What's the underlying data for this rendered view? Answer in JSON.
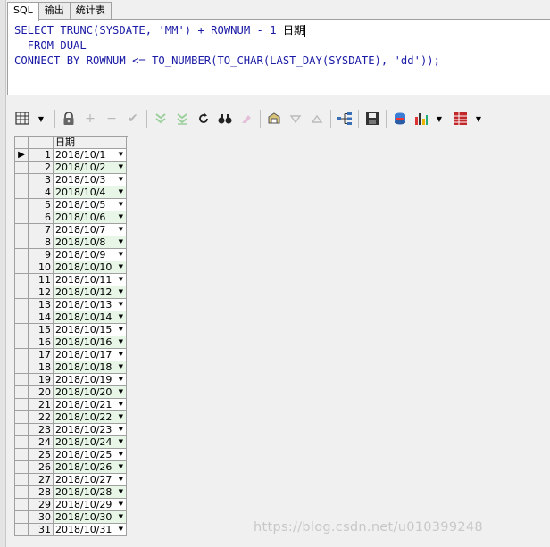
{
  "tabs": [
    {
      "label": "SQL"
    },
    {
      "label": "输出"
    },
    {
      "label": "统计表"
    }
  ],
  "editor": {
    "line1": {
      "a": "SELECT TRUNC(SYSDATE, ",
      "b": "'MM'",
      "c": ") + ROWNUM - ",
      "d": "1",
      "e": " 日期"
    },
    "line2": "  FROM DUAL",
    "line3": {
      "a": "CONNECT BY ROWNUM <= TO_NUMBER(TO_CHAR(LAST_DAY(SYSDATE), ",
      "b": "'dd'",
      "c": "));"
    }
  },
  "toolbar": {
    "icons": [
      "grid-layout-icon",
      "lock-icon",
      "add-row-icon",
      "delete-row-icon",
      "post-icon",
      "fetch-next-icon",
      "fetch-last-icon",
      "refresh-icon",
      "find-icon",
      "clear-icon",
      "query-by-example-icon",
      "sort-desc-icon",
      "sort-asc-icon",
      "tree-icon",
      "save-icon",
      "export-icon",
      "chart-icon",
      "table-icon"
    ]
  },
  "grid": {
    "header": "日期",
    "rows": [
      {
        "n": "1",
        "v": "2018/10/1"
      },
      {
        "n": "2",
        "v": "2018/10/2"
      },
      {
        "n": "3",
        "v": "2018/10/3"
      },
      {
        "n": "4",
        "v": "2018/10/4"
      },
      {
        "n": "5",
        "v": "2018/10/5"
      },
      {
        "n": "6",
        "v": "2018/10/6"
      },
      {
        "n": "7",
        "v": "2018/10/7"
      },
      {
        "n": "8",
        "v": "2018/10/8"
      },
      {
        "n": "9",
        "v": "2018/10/9"
      },
      {
        "n": "10",
        "v": "2018/10/10"
      },
      {
        "n": "11",
        "v": "2018/10/11"
      },
      {
        "n": "12",
        "v": "2018/10/12"
      },
      {
        "n": "13",
        "v": "2018/10/13"
      },
      {
        "n": "14",
        "v": "2018/10/14"
      },
      {
        "n": "15",
        "v": "2018/10/15"
      },
      {
        "n": "16",
        "v": "2018/10/16"
      },
      {
        "n": "17",
        "v": "2018/10/17"
      },
      {
        "n": "18",
        "v": "2018/10/18"
      },
      {
        "n": "19",
        "v": "2018/10/19"
      },
      {
        "n": "20",
        "v": "2018/10/20"
      },
      {
        "n": "21",
        "v": "2018/10/21"
      },
      {
        "n": "22",
        "v": "2018/10/22"
      },
      {
        "n": "23",
        "v": "2018/10/23"
      },
      {
        "n": "24",
        "v": "2018/10/24"
      },
      {
        "n": "25",
        "v": "2018/10/25"
      },
      {
        "n": "26",
        "v": "2018/10/26"
      },
      {
        "n": "27",
        "v": "2018/10/27"
      },
      {
        "n": "28",
        "v": "2018/10/28"
      },
      {
        "n": "29",
        "v": "2018/10/29"
      },
      {
        "n": "30",
        "v": "2018/10/30"
      },
      {
        "n": "31",
        "v": "2018/10/31"
      }
    ]
  },
  "watermark": "https://blog.csdn.net/u010399248"
}
